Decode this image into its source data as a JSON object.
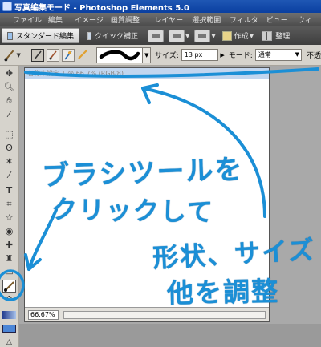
{
  "window": {
    "title": "写真編集モード - Photoshop Elements 5.0"
  },
  "menu": [
    "ファイル",
    "編集",
    "イメージ",
    "画質調整",
    "レイヤー",
    "選択範囲",
    "フィルタ",
    "ビュー",
    "ウィ"
  ],
  "modes": {
    "standard_edit": "スタンダード編集",
    "quick_fix": "クイック補正",
    "create": "作成",
    "organize": "整理"
  },
  "options_bar": {
    "size_label": "サイズ:",
    "size_value": "13 px",
    "mode_label": "モード:",
    "mode_value": "通常",
    "opacity_label": "不透"
  },
  "document": {
    "title": "名称未設定 1 @ 66.7% (RGB/8)",
    "zoom": "66.67%"
  },
  "annotations": {
    "line1": "ブラシツールを",
    "line2": "クリックして",
    "line3": "形状、サイズ",
    "line4": "他を調整",
    "color": "#1b8fd6"
  },
  "colors": {
    "titlebar": "#0a3fa0",
    "menubar": "#4b4b4b",
    "panel": "#d6d3cc",
    "workspace": "#a9a9a9"
  }
}
